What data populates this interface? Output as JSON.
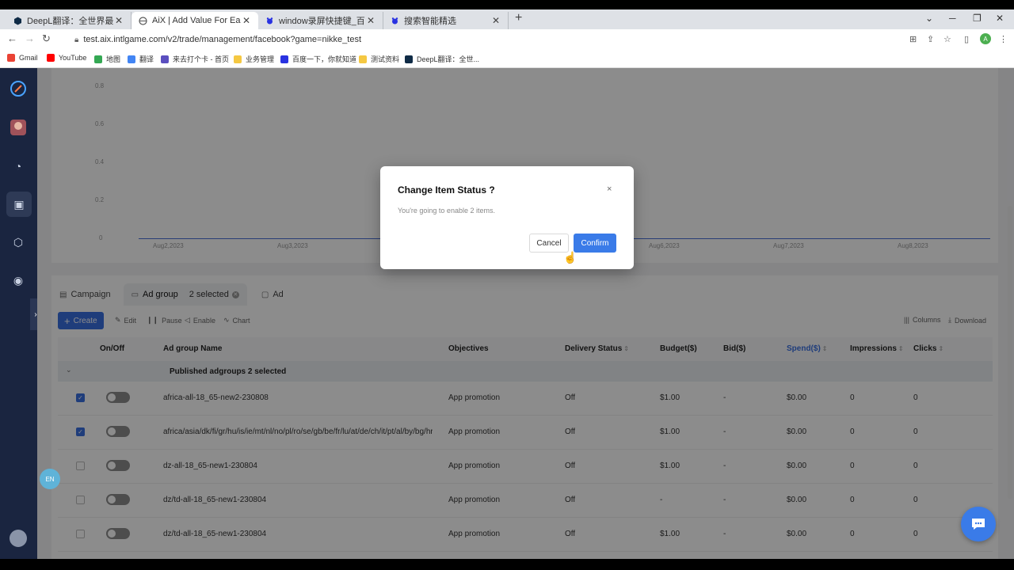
{
  "browser": {
    "tabs": [
      {
        "title": "DeepL翻译：全世界最准确的翻",
        "icon": "deepl-icon",
        "active": false
      },
      {
        "title": "AiX | Add Value For Each Lead",
        "icon": "globe-icon",
        "active": true
      },
      {
        "title": "window录屏快捷键_百度搜索",
        "icon": "baidu-icon",
        "active": false
      },
      {
        "title": "搜索智能精选",
        "icon": "baidu-icon",
        "active": false
      }
    ],
    "url": "test.aix.intlgame.com/v2/trade/management/facebook?game=nikke_test",
    "bookmarks": [
      "Gmail",
      "YouTube",
      "地图",
      "翻译",
      "来去打个卡 - 首页",
      "业务管理",
      "百度一下，你就知道",
      "测试资料",
      "DeepL翻译：全世..."
    ]
  },
  "chart": {
    "yticks": [
      "0.8",
      "0.6",
      "0.4",
      "0.2",
      "0"
    ],
    "xticks": [
      "Aug2,2023",
      "Aug3,2023",
      "Aug6,2023",
      "Aug7,2023",
      "Aug8,2023"
    ]
  },
  "table": {
    "tabs": {
      "campaign": "Campaign",
      "adgroup": "Ad group",
      "selected": "2 selected",
      "ad": "Ad"
    },
    "toolbar": {
      "create": "Create",
      "edit": "Edit",
      "pause": "Pause",
      "enable": "Enable",
      "chart": "Chart",
      "columns": "Columns",
      "download": "Download"
    },
    "headers": {
      "onoff": "On/Off",
      "name": "Ad group Name",
      "objectives": "Objectives",
      "delivery": "Delivery Status",
      "budget": "Budget($)",
      "bid": "Bid($)",
      "spend": "Spend($)",
      "impressions": "Impressions",
      "clicks": "Clicks"
    },
    "group_summary": "Published adgroups 2 selected",
    "rows": [
      {
        "checked": true,
        "name": "africa-all-18_65-new2-230808",
        "objective": "App promotion",
        "delivery": "Off",
        "budget": "$1.00",
        "bid": "-",
        "spend": "$0.00",
        "impressions": "0",
        "clicks": "0"
      },
      {
        "checked": true,
        "name": "africa/asia/dk/fi/gr/hu/is/ie/mt/nl/no/pl/ro/se/gb/be/fr/lu/at/de/ch/it/pt/al/by/bg/hr/c...",
        "objective": "App promotion",
        "delivery": "Off",
        "budget": "$1.00",
        "bid": "-",
        "spend": "$0.00",
        "impressions": "0",
        "clicks": "0"
      },
      {
        "checked": false,
        "name": "dz-all-18_65-new1-230804",
        "objective": "App promotion",
        "delivery": "Off",
        "budget": "$1.00",
        "bid": "-",
        "spend": "$0.00",
        "impressions": "0",
        "clicks": "0"
      },
      {
        "checked": false,
        "name": "dz/td-all-18_65-new1-230804",
        "objective": "App promotion",
        "delivery": "Off",
        "budget": "-",
        "bid": "-",
        "spend": "$0.00",
        "impressions": "0",
        "clicks": "0"
      },
      {
        "checked": false,
        "name": "dz/td-all-18_65-new1-230804",
        "objective": "App promotion",
        "delivery": "Off",
        "budget": "$1.00",
        "bid": "-",
        "spend": "$0.00",
        "impressions": "0",
        "clicks": "0"
      }
    ]
  },
  "modal": {
    "title": "Change Item Status ?",
    "body": "You're going to enable 2 items.",
    "cancel": "Cancel",
    "confirm": "Confirm",
    "close": "×"
  },
  "colors": {
    "accent": "#3a7be8",
    "sidebar": "#1a2540"
  }
}
